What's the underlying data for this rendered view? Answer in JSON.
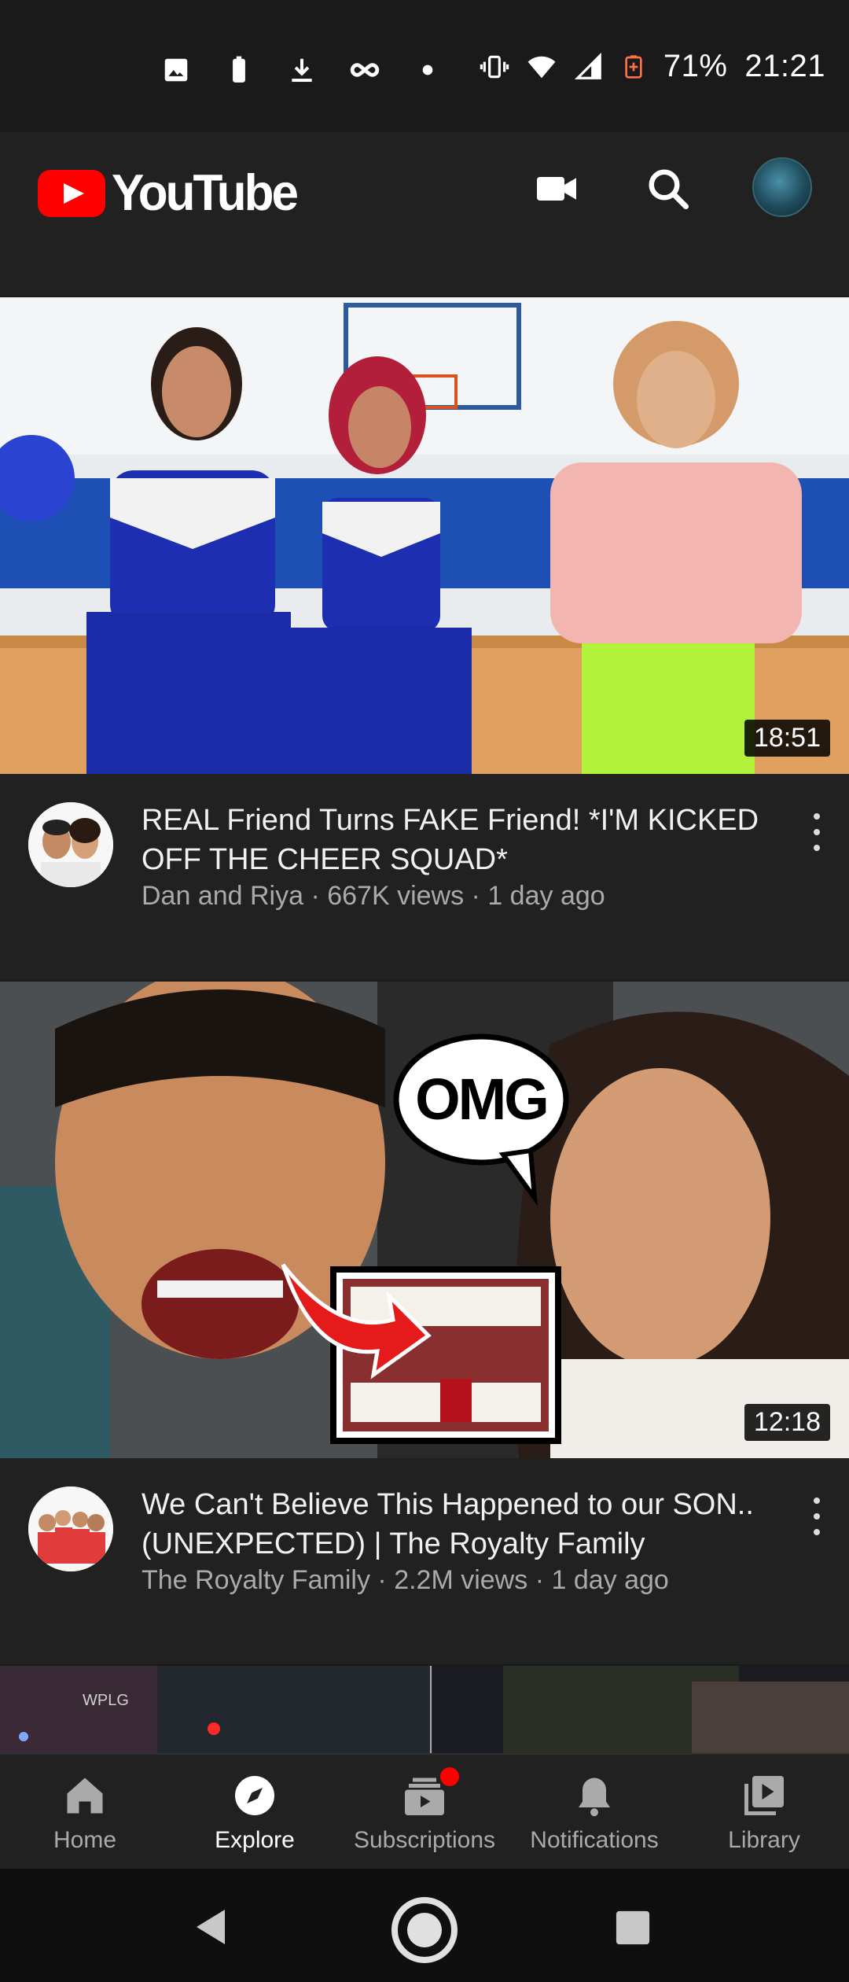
{
  "status_bar": {
    "battery_percent": "71%",
    "time": "21:21"
  },
  "header": {
    "brand": "YouTube",
    "icons": [
      "video-camera-icon",
      "search-icon",
      "account-avatar"
    ]
  },
  "videos": [
    {
      "title": "REAL Friend Turns FAKE Friend! *I'M KICKED OFF THE CHEER SQUAD*",
      "channel": "Dan and Riya",
      "views": "667K views",
      "age": "1 day ago",
      "duration": "18:51"
    },
    {
      "title": "We Can't Believe This Happened to our SON.. (UNEXPECTED) | The Royalty Family",
      "channel": "The Royalty Family",
      "views": "2.2M views",
      "age": "1 day ago",
      "duration": "12:18",
      "thumb_text": "OMG"
    }
  ],
  "third_thumb_text": "WPLG",
  "separator": " · ",
  "bottom_nav": [
    {
      "label": "Home",
      "icon": "home-icon",
      "active": false
    },
    {
      "label": "Explore",
      "icon": "compass-icon",
      "active": true
    },
    {
      "label": "Subscriptions",
      "icon": "subscriptions-icon",
      "active": false,
      "badge": true
    },
    {
      "label": "Notifications",
      "icon": "bell-icon",
      "active": false
    },
    {
      "label": "Library",
      "icon": "library-icon",
      "active": false
    }
  ],
  "colors": {
    "background": "#212121",
    "brand_red": "#ff0000",
    "secondary_text": "#aaaaaa"
  }
}
